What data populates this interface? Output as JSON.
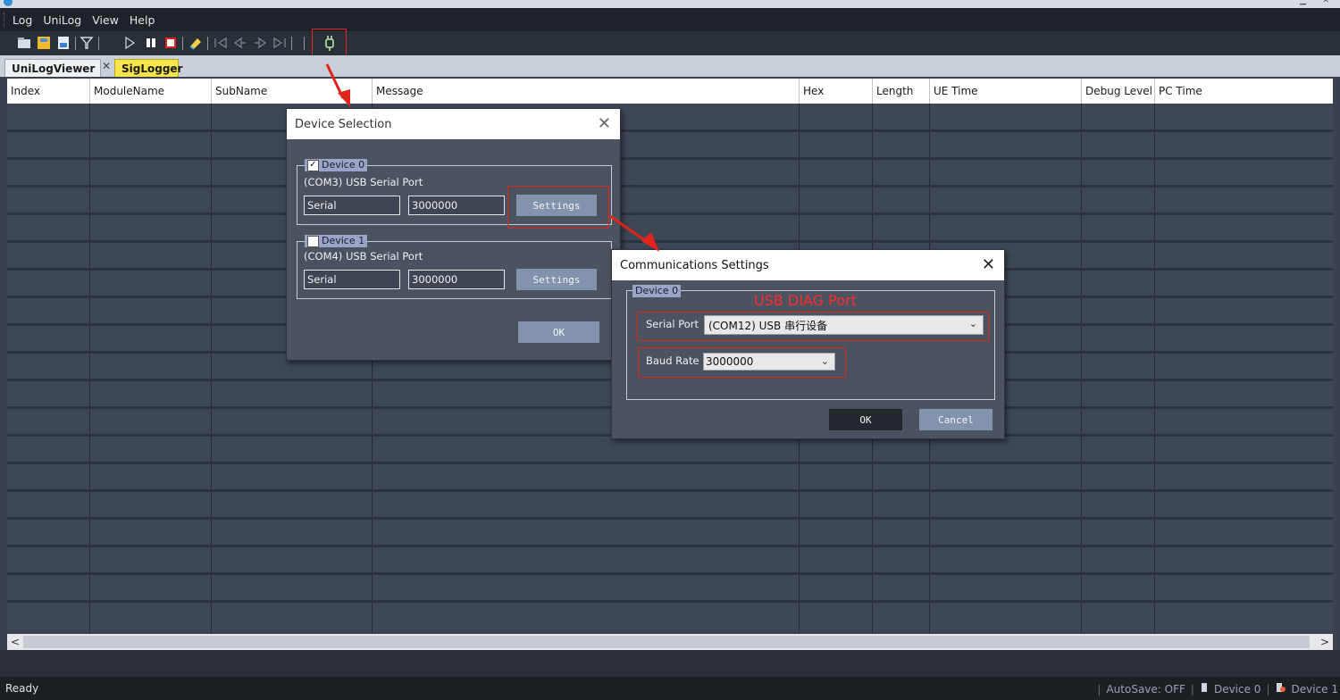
{
  "menu": [
    "Log",
    "UniLog",
    "View",
    "Help"
  ],
  "toolbar_icons": [
    "open-log-icon",
    "save-log-icon",
    "export-icon",
    "filter-icon",
    "play-icon",
    "pause-icon",
    "stop-icon",
    "clear-icon",
    "first-icon",
    "prev-icon",
    "next-icon",
    "last-icon",
    "device-connect-icon"
  ],
  "tabs": [
    {
      "label": "UniLogViewer"
    },
    {
      "label": "SigLogger"
    }
  ],
  "table": {
    "columns": [
      "Index",
      "ModuleName",
      "SubName",
      "Message",
      "Hex",
      "Length",
      "UE Time",
      "Debug Level",
      "PC Time"
    ]
  },
  "device_selection": {
    "title": "Device Selection",
    "devices": [
      {
        "legend": "Device 0",
        "checked": true,
        "port": "(COM3) USB Serial Port",
        "type": "Serial",
        "baud": "3000000",
        "settings_label": "Settings"
      },
      {
        "legend": "Device 1",
        "checked": false,
        "port": "(COM4) USB Serial Port",
        "type": "Serial",
        "baud": "3000000",
        "settings_label": "Settings"
      }
    ],
    "ok_label": "OK"
  },
  "comm_settings": {
    "title": "Communications Settings",
    "group_legend": "Device 0",
    "annotation": "USB DIAG Port",
    "serial_port_label": "Serial Port",
    "serial_port_value": "(COM12) USB 串行设备",
    "baud_rate_label": "Baud Rate",
    "baud_rate_value": "3000000",
    "ok_label": "OK",
    "cancel_label": "Cancel"
  },
  "status": {
    "ready": "Ready",
    "autosave": "AutoSave: OFF",
    "device0": "Device 0",
    "device1": "Device 1"
  },
  "colors": {
    "annotation_red": "#e2241c",
    "grid_bg": "#3d4756",
    "dialog_bg": "#4c5360",
    "button_blue": "#8493ad"
  }
}
